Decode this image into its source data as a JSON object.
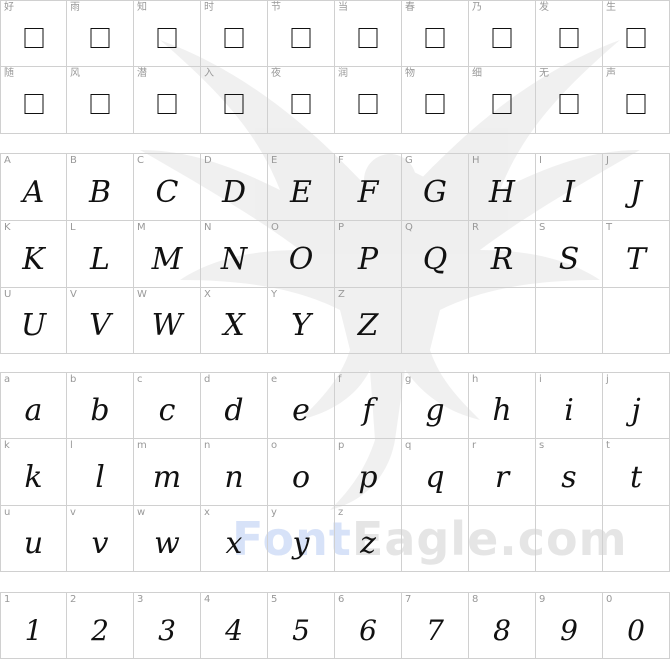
{
  "watermark": {
    "part1": "Font",
    "part2": "Eagle.com"
  },
  "cjk_row1": [
    "好",
    "雨",
    "知",
    "时",
    "节",
    "当",
    "春",
    "乃",
    "发",
    "生"
  ],
  "cjk_row2": [
    "随",
    "风",
    "潜",
    "入",
    "夜",
    "润",
    "物",
    "细",
    "无",
    "声"
  ],
  "upper_rows": [
    [
      "A",
      "B",
      "C",
      "D",
      "E",
      "F",
      "G",
      "H",
      "I",
      "J"
    ],
    [
      "K",
      "L",
      "M",
      "N",
      "O",
      "P",
      "Q",
      "R",
      "S",
      "T"
    ],
    [
      "U",
      "V",
      "W",
      "X",
      "Y",
      "Z",
      "",
      "",
      "",
      ""
    ]
  ],
  "lower_rows": [
    [
      "a",
      "b",
      "c",
      "d",
      "e",
      "f",
      "g",
      "h",
      "i",
      "j"
    ],
    [
      "k",
      "l",
      "m",
      "n",
      "o",
      "p",
      "q",
      "r",
      "s",
      "t"
    ],
    [
      "u",
      "v",
      "w",
      "x",
      "y",
      "z",
      "",
      "",
      "",
      ""
    ]
  ],
  "digit_row": [
    "1",
    "2",
    "3",
    "4",
    "5",
    "6",
    "7",
    "8",
    "9",
    "0"
  ]
}
